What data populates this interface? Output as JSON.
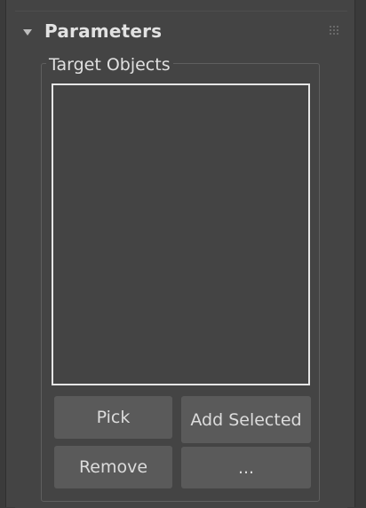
{
  "rollout": {
    "title": "Parameters",
    "collapse_icon": "triangle-down-icon",
    "drag_icon": "grip-dots-icon"
  },
  "target_objects": {
    "group_label": "Target Objects",
    "list_items": []
  },
  "buttons": {
    "pick": "Pick",
    "add_selected": "Add Selected",
    "remove": "Remove",
    "more": "..."
  },
  "colors": {
    "panel_bg": "#444444",
    "button_bg": "#5a5a5a",
    "text": "#dcdcdc",
    "list_border": "#e6e6e6"
  }
}
